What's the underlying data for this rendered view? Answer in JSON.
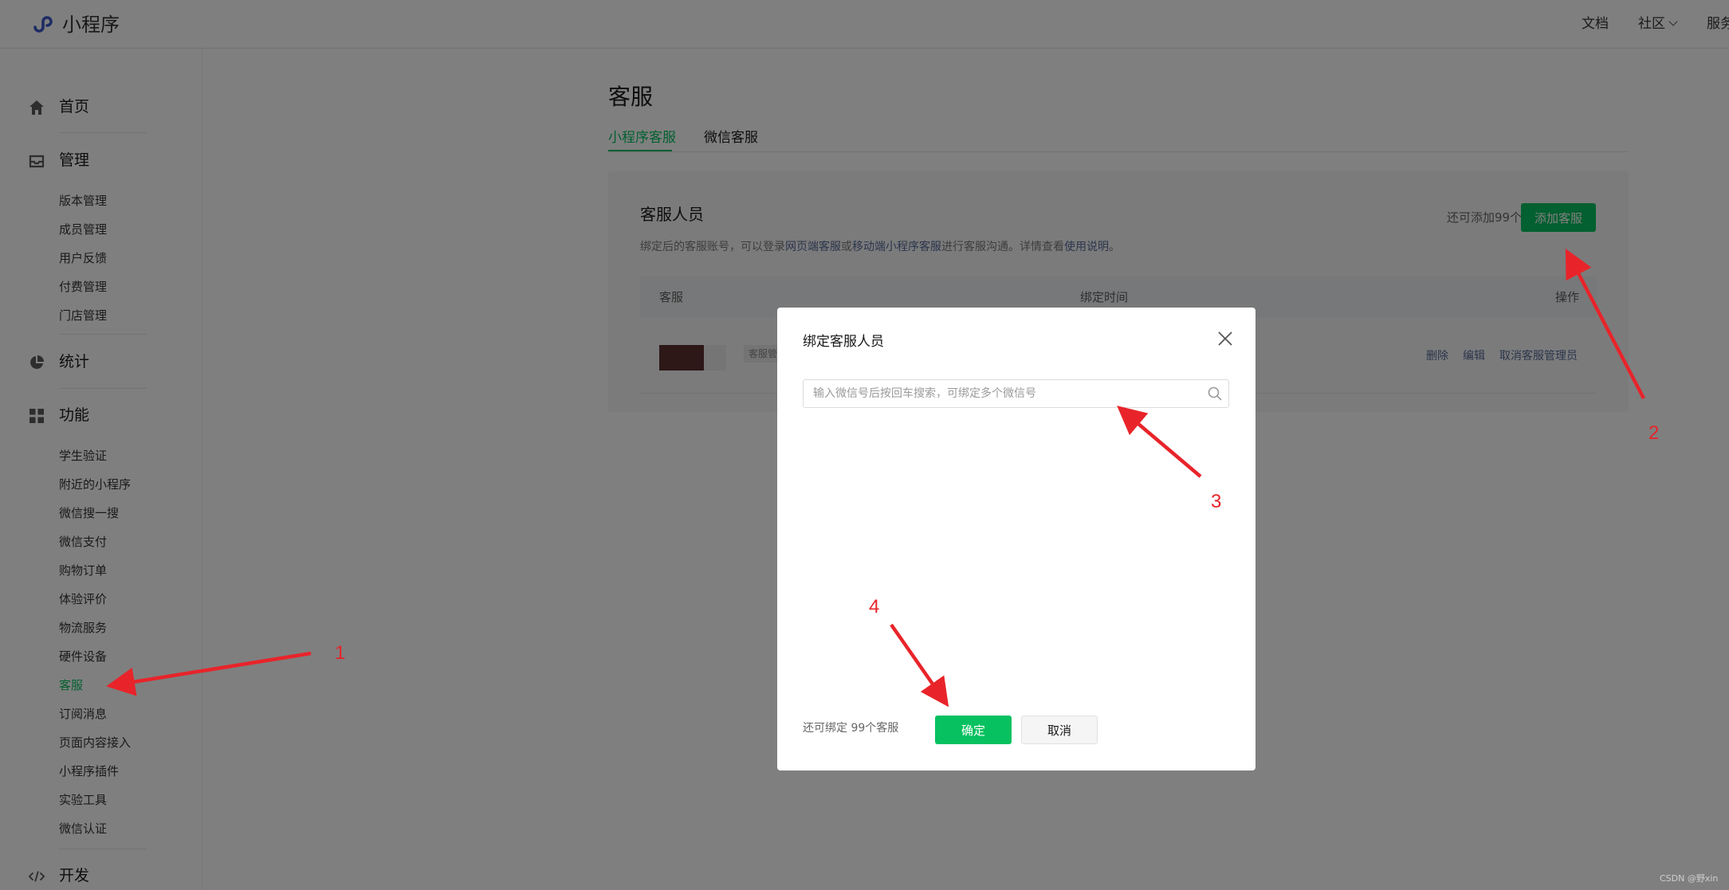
{
  "header": {
    "brand": "小程序",
    "nav": {
      "docs": "文档",
      "community": "社区",
      "service": "服务"
    }
  },
  "sidebar": {
    "home": "首页",
    "manage": {
      "label": "管理",
      "items": [
        "版本管理",
        "成员管理",
        "用户反馈",
        "付费管理",
        "门店管理"
      ]
    },
    "stats": "统计",
    "features": {
      "label": "功能",
      "items": [
        "学生验证",
        "附近的小程序",
        "微信搜一搜",
        "微信支付",
        "购物订单",
        "体验评价",
        "物流服务",
        "硬件设备",
        "客服",
        "订阅消息",
        "页面内容接入",
        "小程序插件",
        "实验工具",
        "微信认证"
      ],
      "active": "客服"
    },
    "dev": "开发"
  },
  "main": {
    "title": "客服",
    "tabs": [
      "小程序客服",
      "微信客服"
    ],
    "card": {
      "title": "客服人员",
      "remain": "还可添加99个",
      "add_button": "添加客服",
      "desc": {
        "p1": "绑定后的客服账号，可以登录",
        "l1": "网页端客服",
        "p2": "或",
        "l2": "移动端小程序客服",
        "p3": "进行客服沟通。详情查看",
        "l3": "使用说明",
        "p4": "。"
      },
      "table": {
        "headers": [
          "客服",
          "绑定时间",
          "操作"
        ],
        "row": {
          "tag": "客服管",
          "actions": [
            "删除",
            "编辑",
            "取消客服管理员"
          ]
        }
      }
    }
  },
  "dialog": {
    "title": "绑定客服人员",
    "search_placeholder": "输入微信号后按回车搜索，可绑定多个微信号",
    "remain": "还可绑定 99个客服",
    "confirm": "确定",
    "cancel": "取消"
  },
  "annotations": [
    "1",
    "2",
    "3",
    "4"
  ],
  "watermark": "CSDN @野xin",
  "colors": {
    "accent": "#07c160",
    "link": "#576b95",
    "annotation": "#e8242a"
  }
}
